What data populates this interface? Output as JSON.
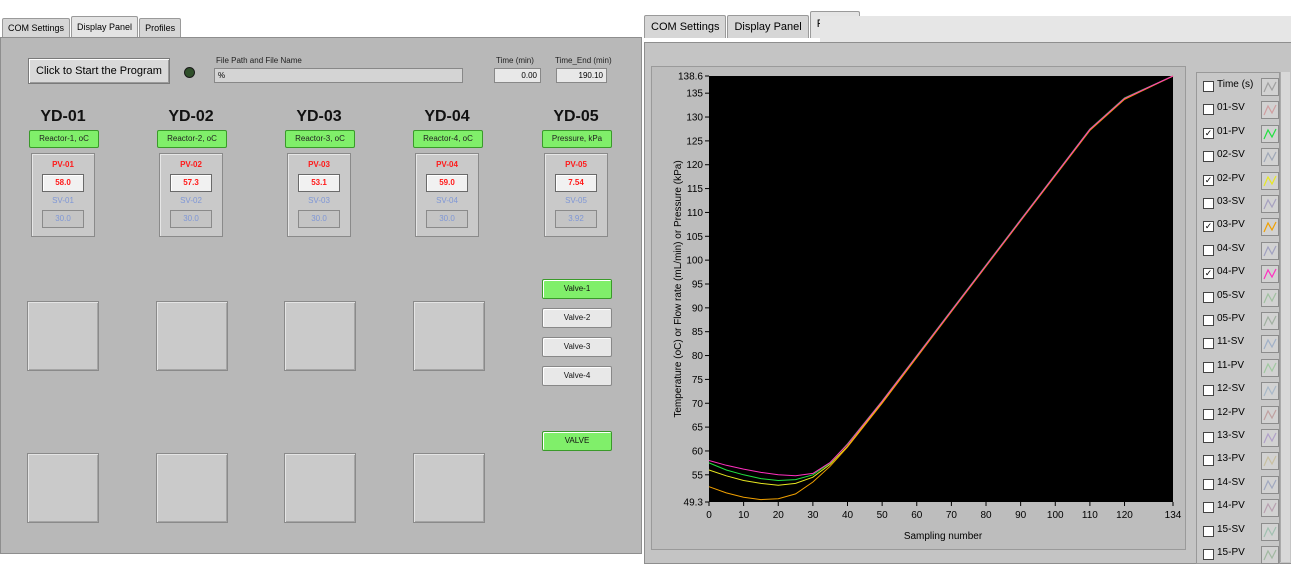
{
  "left_panel": {
    "tabs": [
      "COM Settings",
      "Display Panel",
      "Profiles"
    ],
    "active_tab": "Display Panel",
    "start_button": "Click to Start the Program",
    "file_path_label": "File Path and File Name",
    "file_path_value": "%",
    "time_label": "Time (min)",
    "time_value": "0.00",
    "time_end_label": "Time_End (min)",
    "time_end_value": "190.10",
    "units": [
      {
        "title": "YD-01",
        "label": "Reactor-1, oC",
        "pv_label": "PV-01",
        "pv": "58.0",
        "sv_label": "SV-01",
        "sv": "30.0"
      },
      {
        "title": "YD-02",
        "label": "Reactor-2, oC",
        "pv_label": "PV-02",
        "pv": "57.3",
        "sv_label": "SV-02",
        "sv": "30.0"
      },
      {
        "title": "YD-03",
        "label": "Reactor-3, oC",
        "pv_label": "PV-03",
        "pv": "53.1",
        "sv_label": "SV-03",
        "sv": "30.0"
      },
      {
        "title": "YD-04",
        "label": "Reactor-4, oC",
        "pv_label": "PV-04",
        "pv": "59.0",
        "sv_label": "SV-04",
        "sv": "30.0"
      },
      {
        "title": "YD-05",
        "label": "Pressure, kPa",
        "pv_label": "PV-05",
        "pv": "7.54",
        "sv_label": "SV-05",
        "sv": "3.92"
      }
    ],
    "valves": [
      {
        "label": "Valve-1",
        "on": true
      },
      {
        "label": "Valve-2",
        "on": false
      },
      {
        "label": "Valve-3",
        "on": false
      },
      {
        "label": "Valve-4",
        "on": false
      }
    ],
    "valve_main": "VALVE"
  },
  "right_panel": {
    "tabs": [
      "COM Settings",
      "Display Panel",
      "Profiles"
    ],
    "active_tab": "Profiles",
    "legend": [
      {
        "name": "Time (s)",
        "checked": false,
        "color": "#a0a0a0"
      },
      {
        "name": "01-SV",
        "checked": false,
        "color": "#d09ea0"
      },
      {
        "name": "01-PV",
        "checked": true,
        "color": "#20e040"
      },
      {
        "name": "02-SV",
        "checked": false,
        "color": "#9fa7b7"
      },
      {
        "name": "02-PV",
        "checked": true,
        "color": "#e8e820"
      },
      {
        "name": "03-SV",
        "checked": false,
        "color": "#a6a0c0"
      },
      {
        "name": "03-PV",
        "checked": true,
        "color": "#f0a000"
      },
      {
        "name": "04-SV",
        "checked": false,
        "color": "#a0a0c0"
      },
      {
        "name": "04-PV",
        "checked": true,
        "color": "#ff30c0"
      },
      {
        "name": "05-SV",
        "checked": false,
        "color": "#a0c0a0"
      },
      {
        "name": "05-PV",
        "checked": false,
        "color": "#a0b0a0"
      },
      {
        "name": "11-SV",
        "checked": false,
        "color": "#a0b0c8"
      },
      {
        "name": "11-PV",
        "checked": false,
        "color": "#a0c8a0"
      },
      {
        "name": "12-SV",
        "checked": false,
        "color": "#a8b8c8"
      },
      {
        "name": "12-PV",
        "checked": false,
        "color": "#c0a0a0"
      },
      {
        "name": "13-SV",
        "checked": false,
        "color": "#b0a0c8"
      },
      {
        "name": "13-PV",
        "checked": false,
        "color": "#c8c0a0"
      },
      {
        "name": "14-SV",
        "checked": false,
        "color": "#a0a8c0"
      },
      {
        "name": "14-PV",
        "checked": false,
        "color": "#b8a0b0"
      },
      {
        "name": "15-SV",
        "checked": false,
        "color": "#a0c0b0"
      },
      {
        "name": "15-PV",
        "checked": false,
        "color": "#a0b8a0"
      }
    ]
  },
  "chart_data": {
    "type": "line",
    "xlabel": "Sampling number",
    "ylabel": "Temperature (oC) or Flow rate (mL/min) or Pressure (kPa)",
    "xlim": [
      0,
      134
    ],
    "ylim": [
      49.3,
      138.6
    ],
    "x_ticks": [
      0,
      10,
      20,
      30,
      40,
      50,
      60,
      70,
      80,
      90,
      100,
      110,
      120,
      134
    ],
    "y_ticks": [
      49.3,
      55,
      60,
      65,
      70,
      75,
      80,
      85,
      90,
      95,
      100,
      105,
      110,
      115,
      120,
      125,
      130,
      135,
      138.6
    ],
    "background": "#000000",
    "grid": false,
    "series": [
      {
        "name": "01-PV",
        "color": "#20e040",
        "x": [
          0,
          5,
          10,
          15,
          20,
          25,
          30,
          35,
          40,
          50,
          60,
          70,
          80,
          90,
          100,
          110,
          120,
          134
        ],
        "y": [
          57.5,
          56.0,
          55.0,
          54.2,
          53.8,
          54.0,
          55.0,
          57.5,
          61.5,
          70.5,
          80.0,
          89.5,
          99.0,
          108.5,
          118.0,
          127.5,
          134.0,
          138.6
        ]
      },
      {
        "name": "02-PV",
        "color": "#e8e820",
        "x": [
          0,
          5,
          10,
          15,
          20,
          25,
          30,
          35,
          40,
          50,
          60,
          70,
          80,
          90,
          100,
          110,
          120,
          134
        ],
        "y": [
          56.0,
          54.8,
          53.8,
          53.2,
          52.8,
          53.2,
          54.5,
          57.2,
          61.0,
          70.2,
          79.8,
          89.3,
          98.8,
          108.3,
          117.8,
          127.3,
          133.8,
          138.6
        ]
      },
      {
        "name": "03-PV",
        "color": "#f0a000",
        "x": [
          0,
          5,
          10,
          15,
          20,
          25,
          30,
          35,
          40,
          50,
          60,
          70,
          80,
          90,
          100,
          110,
          120,
          134
        ],
        "y": [
          52.5,
          51.2,
          50.3,
          49.8,
          50.0,
          51.0,
          53.5,
          56.8,
          60.8,
          70.0,
          79.6,
          89.2,
          98.7,
          108.2,
          117.7,
          127.2,
          133.7,
          138.6
        ]
      },
      {
        "name": "04-PV",
        "color": "#ff30c0",
        "x": [
          0,
          5,
          10,
          15,
          20,
          25,
          30,
          35,
          40,
          50,
          60,
          70,
          80,
          90,
          100,
          110,
          120,
          134
        ],
        "y": [
          58.0,
          57.0,
          56.2,
          55.5,
          55.0,
          54.8,
          55.3,
          57.6,
          61.4,
          70.4,
          79.9,
          89.4,
          98.9,
          108.4,
          117.9,
          127.4,
          133.9,
          138.6
        ]
      }
    ]
  }
}
